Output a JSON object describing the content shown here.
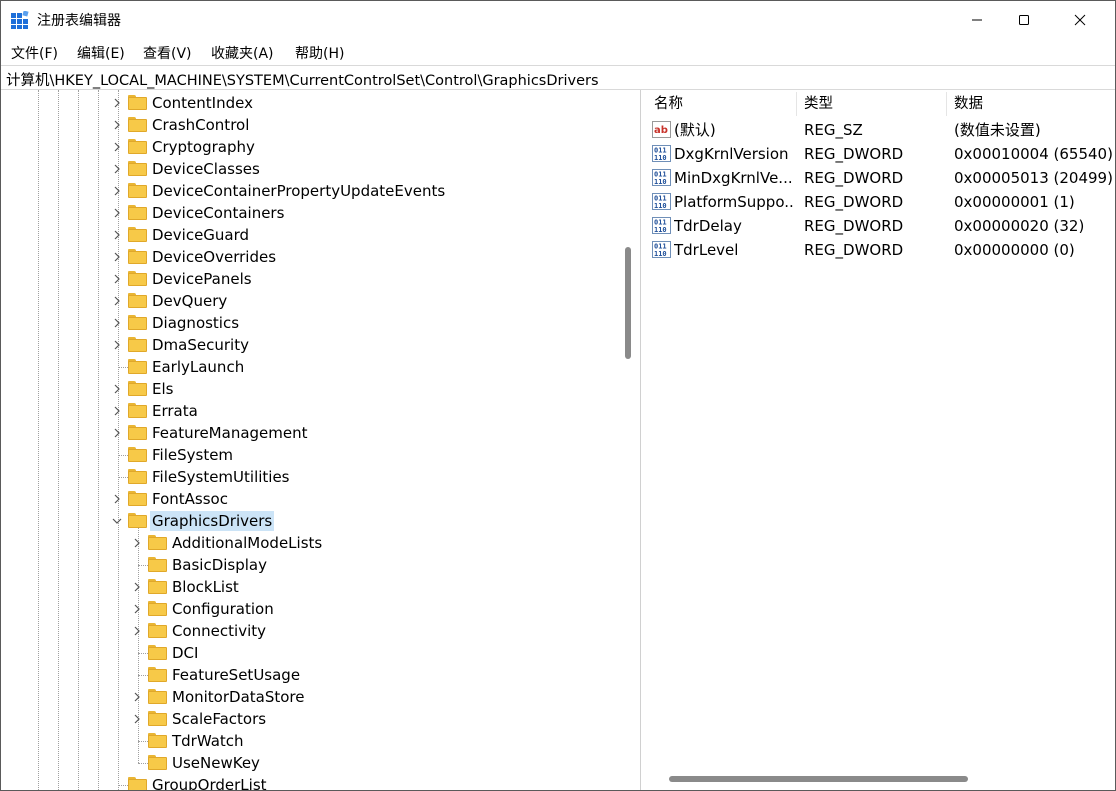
{
  "window": {
    "title": "注册表编辑器",
    "controls": {
      "minimize_icon": "minimize-icon",
      "maximize_icon": "maximize-icon",
      "close_icon": "close-icon"
    }
  },
  "menu": [
    "文件(F)",
    "编辑(E)",
    "查看(V)",
    "收藏夹(A)",
    "帮助(H)"
  ],
  "address": "计算机\\HKEY_LOCAL_MACHINE\\SYSTEM\\CurrentControlSet\\Control\\GraphicsDrivers",
  "tree": {
    "items": [
      {
        "label": "ContentIndex",
        "expandable": true,
        "level": 0
      },
      {
        "label": "CrashControl",
        "expandable": true,
        "level": 0
      },
      {
        "label": "Cryptography",
        "expandable": true,
        "level": 0
      },
      {
        "label": "DeviceClasses",
        "expandable": true,
        "level": 0
      },
      {
        "label": "DeviceContainerPropertyUpdateEvents",
        "expandable": true,
        "level": 0
      },
      {
        "label": "DeviceContainers",
        "expandable": true,
        "level": 0
      },
      {
        "label": "DeviceGuard",
        "expandable": true,
        "level": 0
      },
      {
        "label": "DeviceOverrides",
        "expandable": true,
        "level": 0
      },
      {
        "label": "DevicePanels",
        "expandable": true,
        "level": 0
      },
      {
        "label": "DevQuery",
        "expandable": true,
        "level": 0
      },
      {
        "label": "Diagnostics",
        "expandable": true,
        "level": 0
      },
      {
        "label": "DmaSecurity",
        "expandable": true,
        "level": 0
      },
      {
        "label": "EarlyLaunch",
        "expandable": false,
        "level": 0
      },
      {
        "label": "Els",
        "expandable": true,
        "level": 0
      },
      {
        "label": "Errata",
        "expandable": true,
        "level": 0
      },
      {
        "label": "FeatureManagement",
        "expandable": true,
        "level": 0
      },
      {
        "label": "FileSystem",
        "expandable": false,
        "level": 0
      },
      {
        "label": "FileSystemUtilities",
        "expandable": false,
        "level": 0
      },
      {
        "label": "FontAssoc",
        "expandable": true,
        "level": 0
      },
      {
        "label": "GraphicsDrivers",
        "expandable": true,
        "expanded": true,
        "selected": true,
        "level": 0
      },
      {
        "label": "AdditionalModeLists",
        "expandable": true,
        "level": 1
      },
      {
        "label": "BasicDisplay",
        "expandable": false,
        "level": 1
      },
      {
        "label": "BlockList",
        "expandable": true,
        "level": 1
      },
      {
        "label": "Configuration",
        "expandable": true,
        "level": 1
      },
      {
        "label": "Connectivity",
        "expandable": true,
        "level": 1
      },
      {
        "label": "DCI",
        "expandable": false,
        "level": 1
      },
      {
        "label": "FeatureSetUsage",
        "expandable": false,
        "level": 1
      },
      {
        "label": "MonitorDataStore",
        "expandable": true,
        "level": 1
      },
      {
        "label": "ScaleFactors",
        "expandable": true,
        "level": 1
      },
      {
        "label": "TdrWatch",
        "expandable": false,
        "level": 1
      },
      {
        "label": "UseNewKey",
        "expandable": false,
        "level": 1
      },
      {
        "label": "GroupOrderList",
        "expandable": false,
        "level": 0
      }
    ]
  },
  "list": {
    "columns": [
      "名称",
      "类型",
      "数据"
    ],
    "rows": [
      {
        "icon": "string-value-icon",
        "name": "(默认)",
        "type": "REG_SZ",
        "data": "(数值未设置)"
      },
      {
        "icon": "dword-value-icon",
        "name": "DxgKrnlVersion",
        "type": "REG_DWORD",
        "data": "0x00010004 (65540)"
      },
      {
        "icon": "dword-value-icon",
        "name": "MinDxgKrnlVe...",
        "type": "REG_DWORD",
        "data": "0x00005013 (20499)"
      },
      {
        "icon": "dword-value-icon",
        "name": "PlatformSuppo...",
        "type": "REG_DWORD",
        "data": "0x00000001 (1)"
      },
      {
        "icon": "dword-value-icon",
        "name": "TdrDelay",
        "type": "REG_DWORD",
        "data": "0x00000020 (32)"
      },
      {
        "icon": "dword-value-icon",
        "name": "TdrLevel",
        "type": "REG_DWORD",
        "data": "0x00000000 (0)"
      }
    ]
  },
  "colors": {
    "selection": "#cce4f7",
    "folder": "#f7c948",
    "accent": "#1e6fd9"
  }
}
